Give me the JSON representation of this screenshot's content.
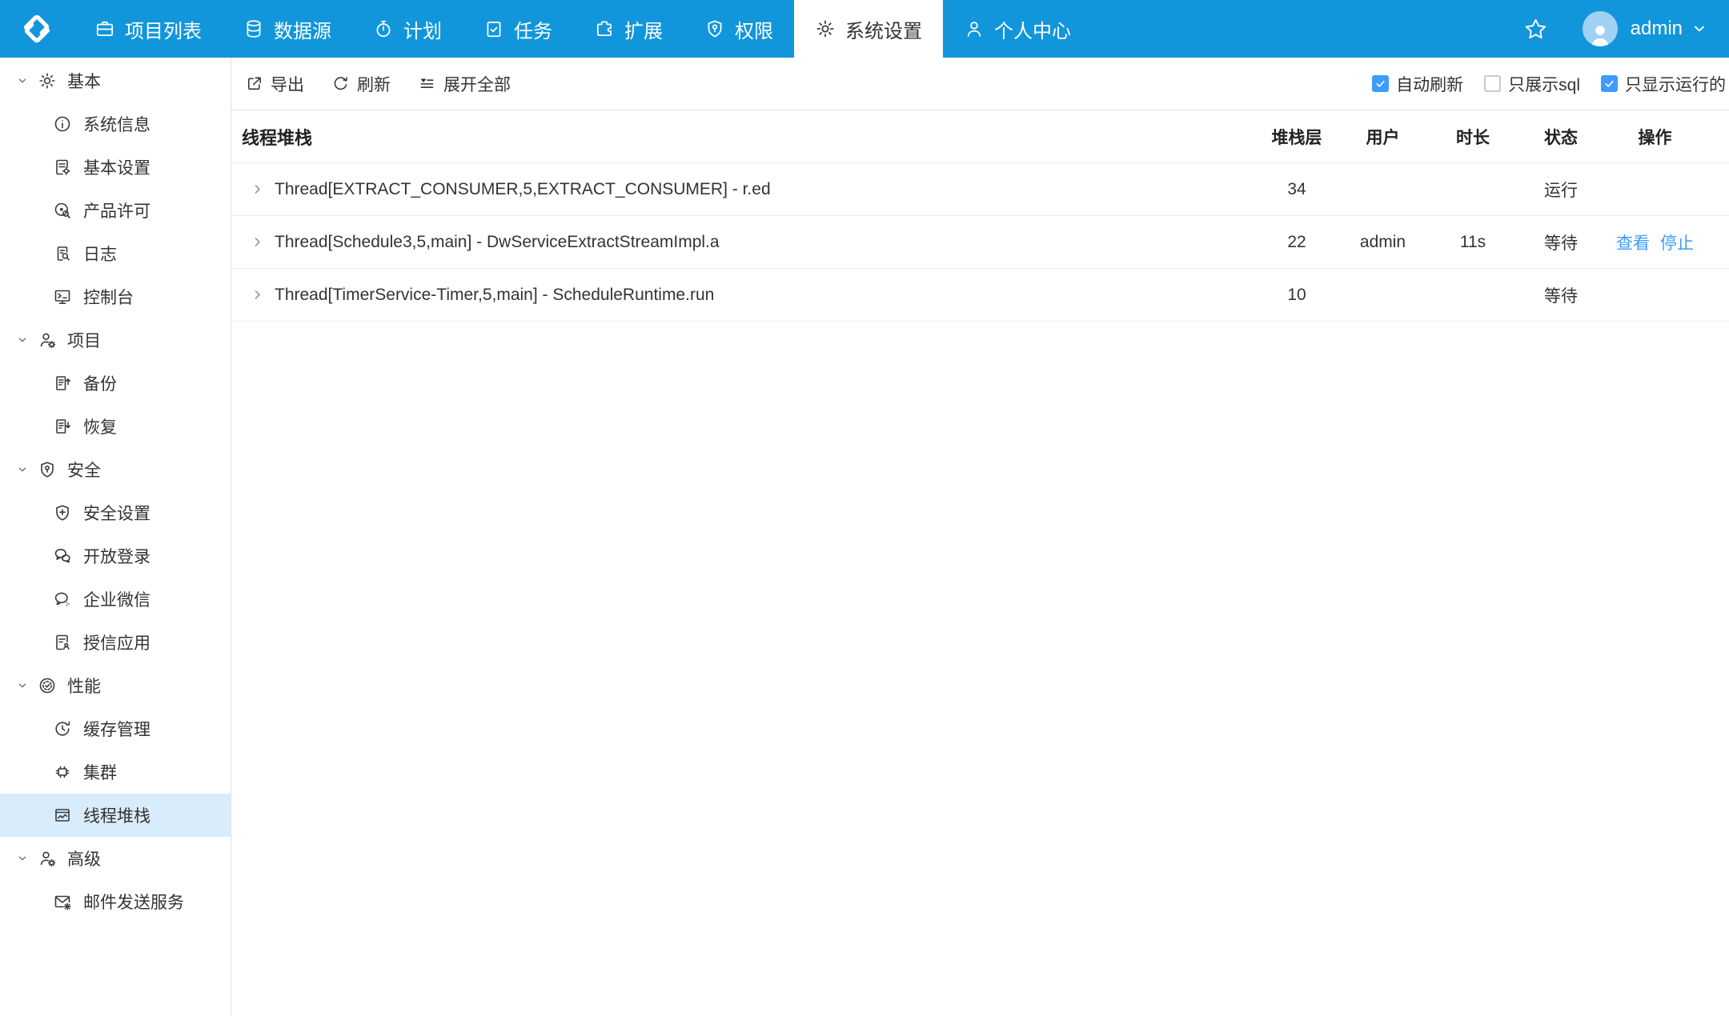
{
  "colors": {
    "navbar_blue": "#1296db",
    "link_blue": "#3d9cfd",
    "checkbox_blue": "#3d9cfd",
    "selected_item_bg": "#d9ecfb"
  },
  "nav": {
    "tabs": [
      {
        "name": "project-list",
        "icon": "briefcase",
        "label": "项目列表",
        "active": false
      },
      {
        "name": "data-source",
        "icon": "database",
        "label": "数据源",
        "active": false
      },
      {
        "name": "schedule",
        "icon": "stopwatch",
        "label": "计划",
        "active": false
      },
      {
        "name": "task",
        "icon": "clipboard-check",
        "label": "任务",
        "active": false
      },
      {
        "name": "extension",
        "icon": "puzzle",
        "label": "扩展",
        "active": false
      },
      {
        "name": "permission",
        "icon": "shield-key",
        "label": "权限",
        "active": false
      },
      {
        "name": "system-settings",
        "icon": "gear",
        "label": "系统设置",
        "active": true
      },
      {
        "name": "personal-center",
        "icon": "person",
        "label": "个人中心",
        "active": false
      }
    ],
    "user": {
      "name": "admin"
    }
  },
  "sidebar": {
    "sections": [
      {
        "name": "basic",
        "icon": "gear",
        "label": "基本",
        "items": [
          {
            "name": "system-info",
            "icon": "info-circle",
            "label": "系统信息",
            "selected": false
          },
          {
            "name": "basic-settings",
            "icon": "doc-gear",
            "label": "基本设置",
            "selected": false
          },
          {
            "name": "product-license",
            "icon": "license",
            "label": "产品许可",
            "selected": false
          },
          {
            "name": "logs",
            "icon": "doc-search",
            "label": "日志",
            "selected": false
          },
          {
            "name": "console",
            "icon": "console",
            "label": "控制台",
            "selected": false
          }
        ]
      },
      {
        "name": "project",
        "icon": "person-gear",
        "label": "项目",
        "items": [
          {
            "name": "backup",
            "icon": "doc-arrow-up",
            "label": "备份",
            "selected": false
          },
          {
            "name": "restore",
            "icon": "doc-arrow-down",
            "label": "恢复",
            "selected": false
          }
        ]
      },
      {
        "name": "security",
        "icon": "shield-key",
        "label": "安全",
        "items": [
          {
            "name": "security-settings",
            "icon": "shield-plus",
            "label": "安全设置",
            "selected": false
          },
          {
            "name": "open-login",
            "icon": "chat-two",
            "label": "开放登录",
            "selected": false
          },
          {
            "name": "wecom",
            "icon": "chat-dots",
            "label": "企业微信",
            "selected": false
          },
          {
            "name": "trusted-apps",
            "icon": "doc-person",
            "label": "授信应用",
            "selected": false
          }
        ]
      },
      {
        "name": "performance",
        "icon": "gauge",
        "label": "性能",
        "items": [
          {
            "name": "cache-management",
            "icon": "clock-refresh",
            "label": "缓存管理",
            "selected": false
          },
          {
            "name": "cluster",
            "icon": "chip",
            "label": "集群",
            "selected": false
          },
          {
            "name": "thread-stack",
            "icon": "thread-stack",
            "label": "线程堆栈",
            "selected": true
          }
        ]
      },
      {
        "name": "advanced",
        "icon": "person-gear",
        "label": "高级",
        "items": [
          {
            "name": "mail-service",
            "icon": "mail-gear",
            "label": "邮件发送服务",
            "selected": false
          }
        ]
      }
    ]
  },
  "toolbar": {
    "buttons": [
      {
        "name": "export",
        "icon": "export",
        "label": "导出"
      },
      {
        "name": "refresh",
        "icon": "refresh",
        "label": "刷新"
      },
      {
        "name": "expand-all",
        "icon": "expand-all",
        "label": "展开全部"
      }
    ],
    "checkboxes": [
      {
        "name": "auto-refresh",
        "label": "自动刷新",
        "checked": true
      },
      {
        "name": "only-sql",
        "label": "只展示sql",
        "checked": false
      },
      {
        "name": "only-running",
        "label": "只显示运行的",
        "checked": true
      }
    ]
  },
  "table": {
    "columns": [
      "线程堆栈",
      "堆栈层",
      "用户",
      "时长",
      "状态",
      "操作"
    ],
    "rows": [
      {
        "thread": "Thread[EXTRACT_CONSUMER,5,EXTRACT_CONSUMER] - r.ed",
        "depth": "34",
        "user": "",
        "duration": "",
        "status": "运行",
        "actions": []
      },
      {
        "thread": "Thread[Schedule3,5,main] - DwServiceExtractStreamImpl.a",
        "depth": "22",
        "user": "admin",
        "duration": "11s",
        "status": "等待",
        "actions": [
          "查看",
          "停止"
        ]
      },
      {
        "thread": "Thread[TimerService-Timer,5,main] - ScheduleRuntime.run",
        "depth": "10",
        "user": "",
        "duration": "",
        "status": "等待",
        "actions": []
      }
    ]
  }
}
